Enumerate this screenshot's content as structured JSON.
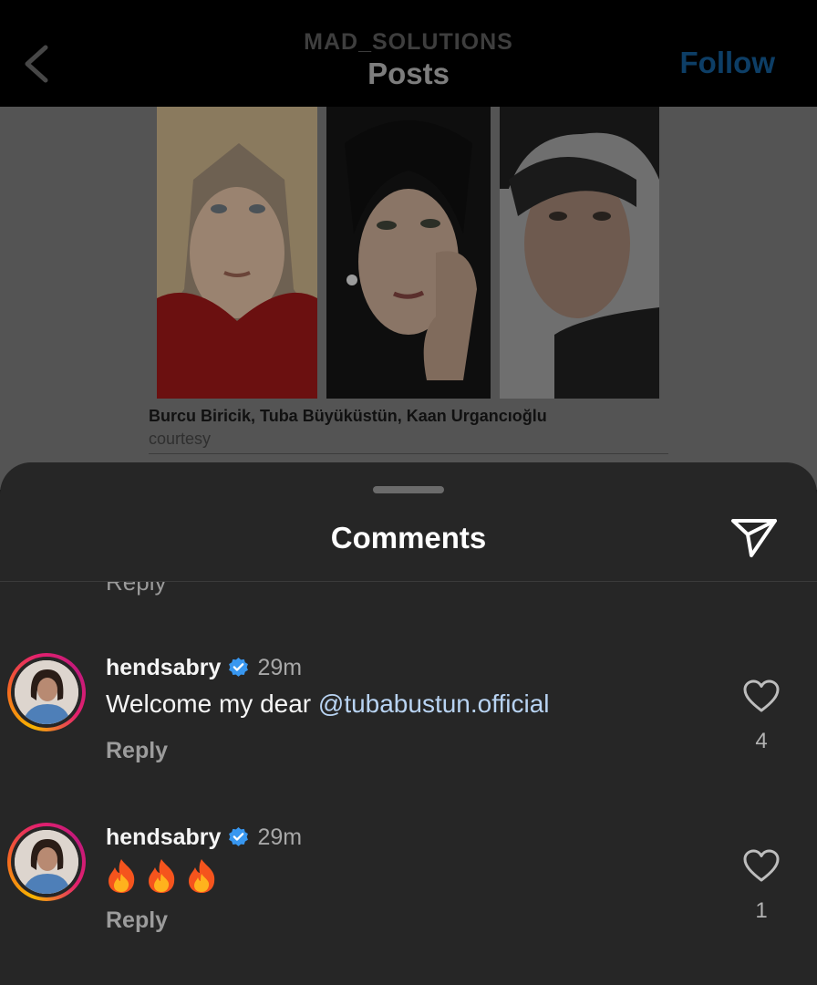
{
  "nav": {
    "account": "MAD_SOLUTIONS",
    "title": "Posts",
    "follow_label": "Follow"
  },
  "post": {
    "caption_names": "Burcu Biricik, Tuba Büyüküstün, Kaan Urgancıoğlu",
    "caption_credit": "courtesy"
  },
  "comments_sheet": {
    "title": "Comments",
    "previous_reply_label": "Reply",
    "items": [
      {
        "username": "hendsabry",
        "time": "29m",
        "text": "Welcome my dear ",
        "mention": "@tubabustun.official",
        "reply_label": "Reply",
        "likes": "4"
      },
      {
        "username": "hendsabry",
        "time": "29m",
        "emoji": [
          "fire-icon",
          "fire-icon",
          "fire-icon"
        ],
        "reply_label": "Reply",
        "likes": "1"
      }
    ]
  },
  "colors": {
    "sheet_bg": "#262626",
    "follow_dimmed": "#0d3e66",
    "mention": "#b8d3f2",
    "verified": "#3897f0"
  }
}
